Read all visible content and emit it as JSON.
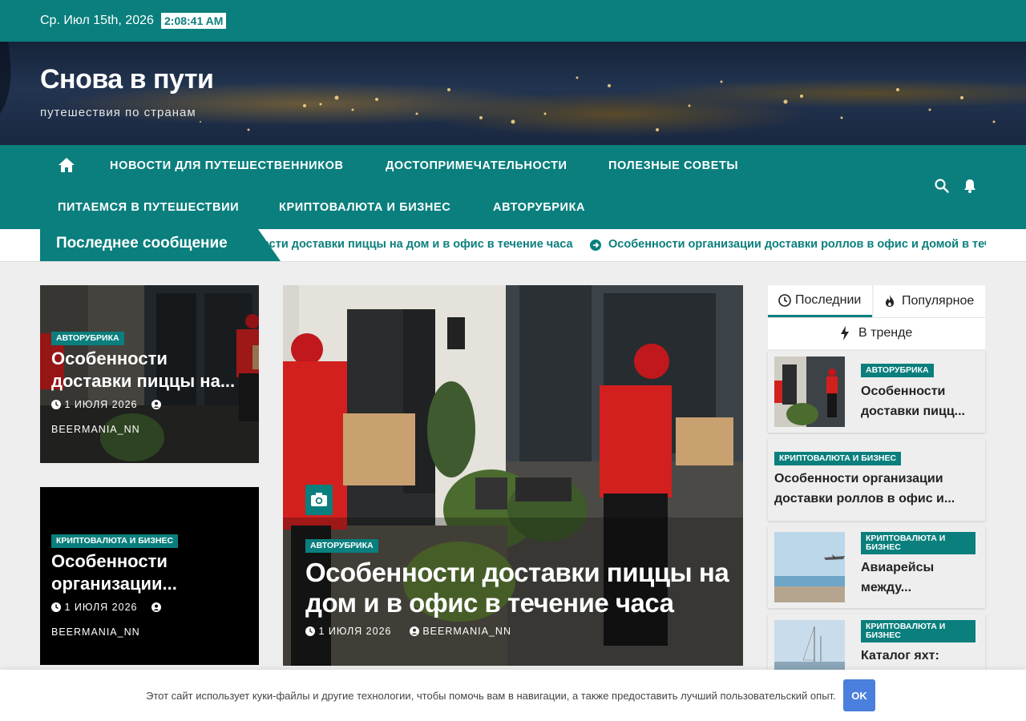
{
  "topbar": {
    "date": "Ср. Июл 15th, 2026",
    "time": "2:08:41 AM"
  },
  "header": {
    "site_title": "Снова в пути",
    "tagline": "путешествия по странам"
  },
  "nav": {
    "items": [
      "НОВОСТИ ДЛЯ ПУТЕШЕСТВЕННИКОВ",
      "ДОСТОПРИМЕЧАТЕЛЬНОСТИ",
      "ПОЛЕЗНЫЕ СОВЕТЫ",
      "ПИТАЕМСЯ В ПУТЕШЕСТВИИ",
      "КРИПТОВАЛЮТА И БИЗНЕС",
      "АВТОРУБРИКА"
    ]
  },
  "ticker": {
    "label": "Последнее сообщение",
    "items": [
      "ости доставки пиццы на дом и в офис в течение часа",
      "Особенности организации доставки роллов в офис и домой в течение"
    ]
  },
  "left_cards": [
    {
      "category": "АВТОРУБРИКА",
      "title": "Особенности доставки пиццы на...",
      "date": "1 ИЮЛЯ 2026",
      "author": "BEERMANIA_NN"
    },
    {
      "category": "КРИПТОВАЛЮТА И БИЗНЕС",
      "title": "Особенности организации...",
      "date": "1 ИЮЛЯ 2026",
      "author": "BEERMANIA_NN"
    }
  ],
  "featured": {
    "category": "АВТОРУБРИКА",
    "title": "Особенности доставки пиццы на дом и в офис в течение часа",
    "date": "1 ИЮЛЯ 2026",
    "author": "BEERMANIA_NN"
  },
  "sidebar": {
    "tabs": [
      "Последнии",
      "Популярное",
      "В тренде"
    ],
    "posts": [
      {
        "category": "АВТОРУБРИКА",
        "title": "Особенности доставки пицц..."
      },
      {
        "category": "КРИПТОВАЛЮТА И БИЗНЕС",
        "title": "Особенности организации доставки роллов в офис и..."
      },
      {
        "category": "КРИПТОВАЛЮТА И БИЗНЕС",
        "title": "Авиарейсы между..."
      },
      {
        "category": "КРИПТОВАЛЮТА И БИЗНЕС",
        "title": "Каталог яхт:"
      }
    ]
  },
  "cookie": {
    "text": "Этот сайт использует куки-файлы и другие технологии, чтобы помочь вам в навигации, а также предоставить лучший пользовательский опыт.",
    "ok": "OK"
  },
  "colors": {
    "accent": "#0a7f7d",
    "ok_button": "#4a7fde"
  }
}
